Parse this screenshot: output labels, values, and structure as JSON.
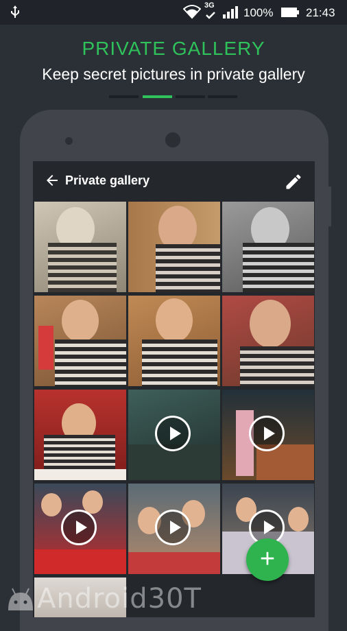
{
  "status_bar": {
    "network_type": "3G",
    "battery_percent": "100%",
    "time": "21:43",
    "icons": [
      "usb-icon",
      "wifi-icon",
      "signal-icon",
      "battery-icon"
    ]
  },
  "header": {
    "title": "PRIVATE GALLERY",
    "subtitle": "Keep secret pictures in private gallery",
    "accent_color": "#2fc25a"
  },
  "pager": {
    "count": 4,
    "active_index": 1
  },
  "app": {
    "title": "Private gallery",
    "icons": [
      "back-arrow-icon",
      "edit-pencil-icon"
    ]
  },
  "gallery": {
    "items": [
      {
        "type": "photo"
      },
      {
        "type": "photo"
      },
      {
        "type": "photo"
      },
      {
        "type": "photo"
      },
      {
        "type": "photo"
      },
      {
        "type": "photo"
      },
      {
        "type": "photo"
      },
      {
        "type": "video"
      },
      {
        "type": "video"
      },
      {
        "type": "video"
      },
      {
        "type": "video"
      },
      {
        "type": "video"
      },
      {
        "type": "photo"
      }
    ]
  },
  "fab": {
    "icon": "add-icon",
    "label": "+"
  },
  "watermark": {
    "text": "Android30T"
  }
}
